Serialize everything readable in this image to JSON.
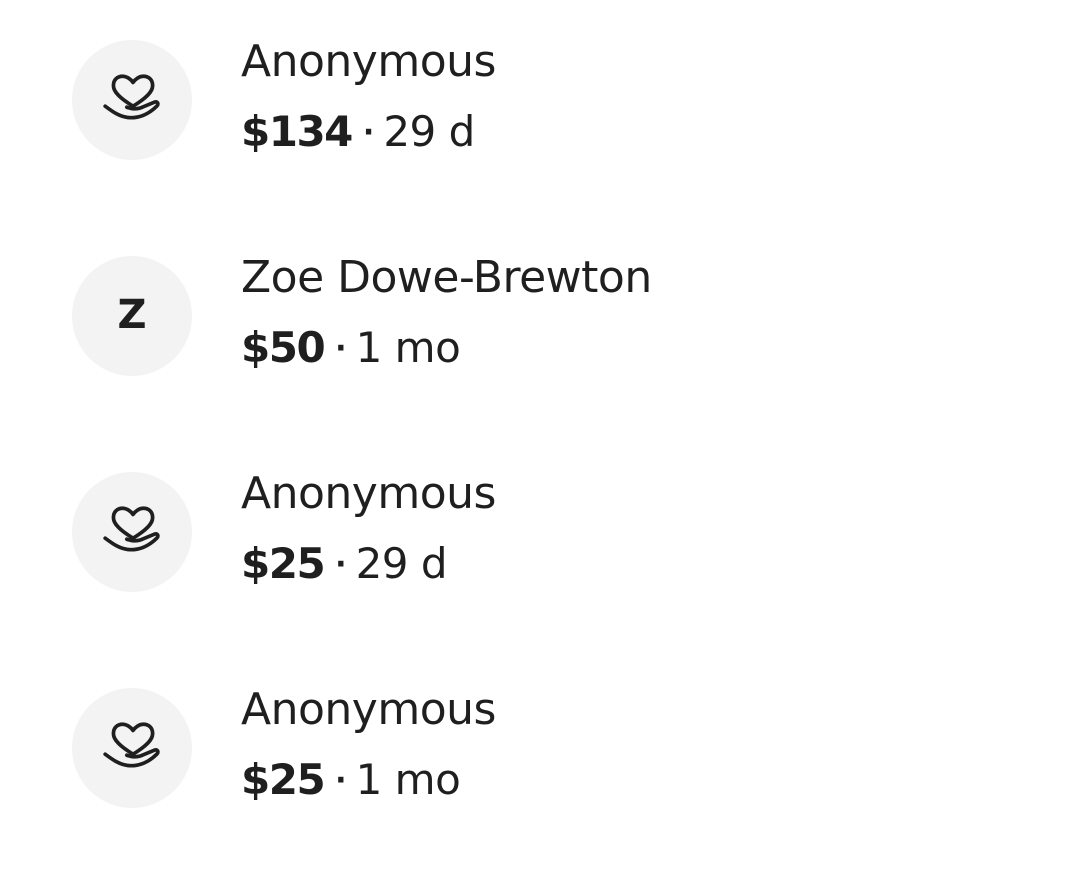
{
  "donations": [
    {
      "donor": "Anonymous",
      "avatar_icon": "heart-in-hand-icon",
      "avatar_initial": "",
      "amount": "$134",
      "separator": "·",
      "time_ago": "29 d"
    },
    {
      "donor": "Zoe Dowe-Brewton",
      "avatar_icon": "",
      "avatar_initial": "Z",
      "amount": "$50",
      "separator": "·",
      "time_ago": "1 mo"
    },
    {
      "donor": "Anonymous",
      "avatar_icon": "heart-in-hand-icon",
      "avatar_initial": "",
      "amount": "$25",
      "separator": "·",
      "time_ago": "29 d"
    },
    {
      "donor": "Anonymous",
      "avatar_icon": "heart-in-hand-icon",
      "avatar_initial": "",
      "amount": "$25",
      "separator": "·",
      "time_ago": "1 mo"
    }
  ],
  "colors": {
    "text": "#1f1f1f",
    "avatar_background": "#f3f3f3",
    "page_background": "#ffffff"
  }
}
